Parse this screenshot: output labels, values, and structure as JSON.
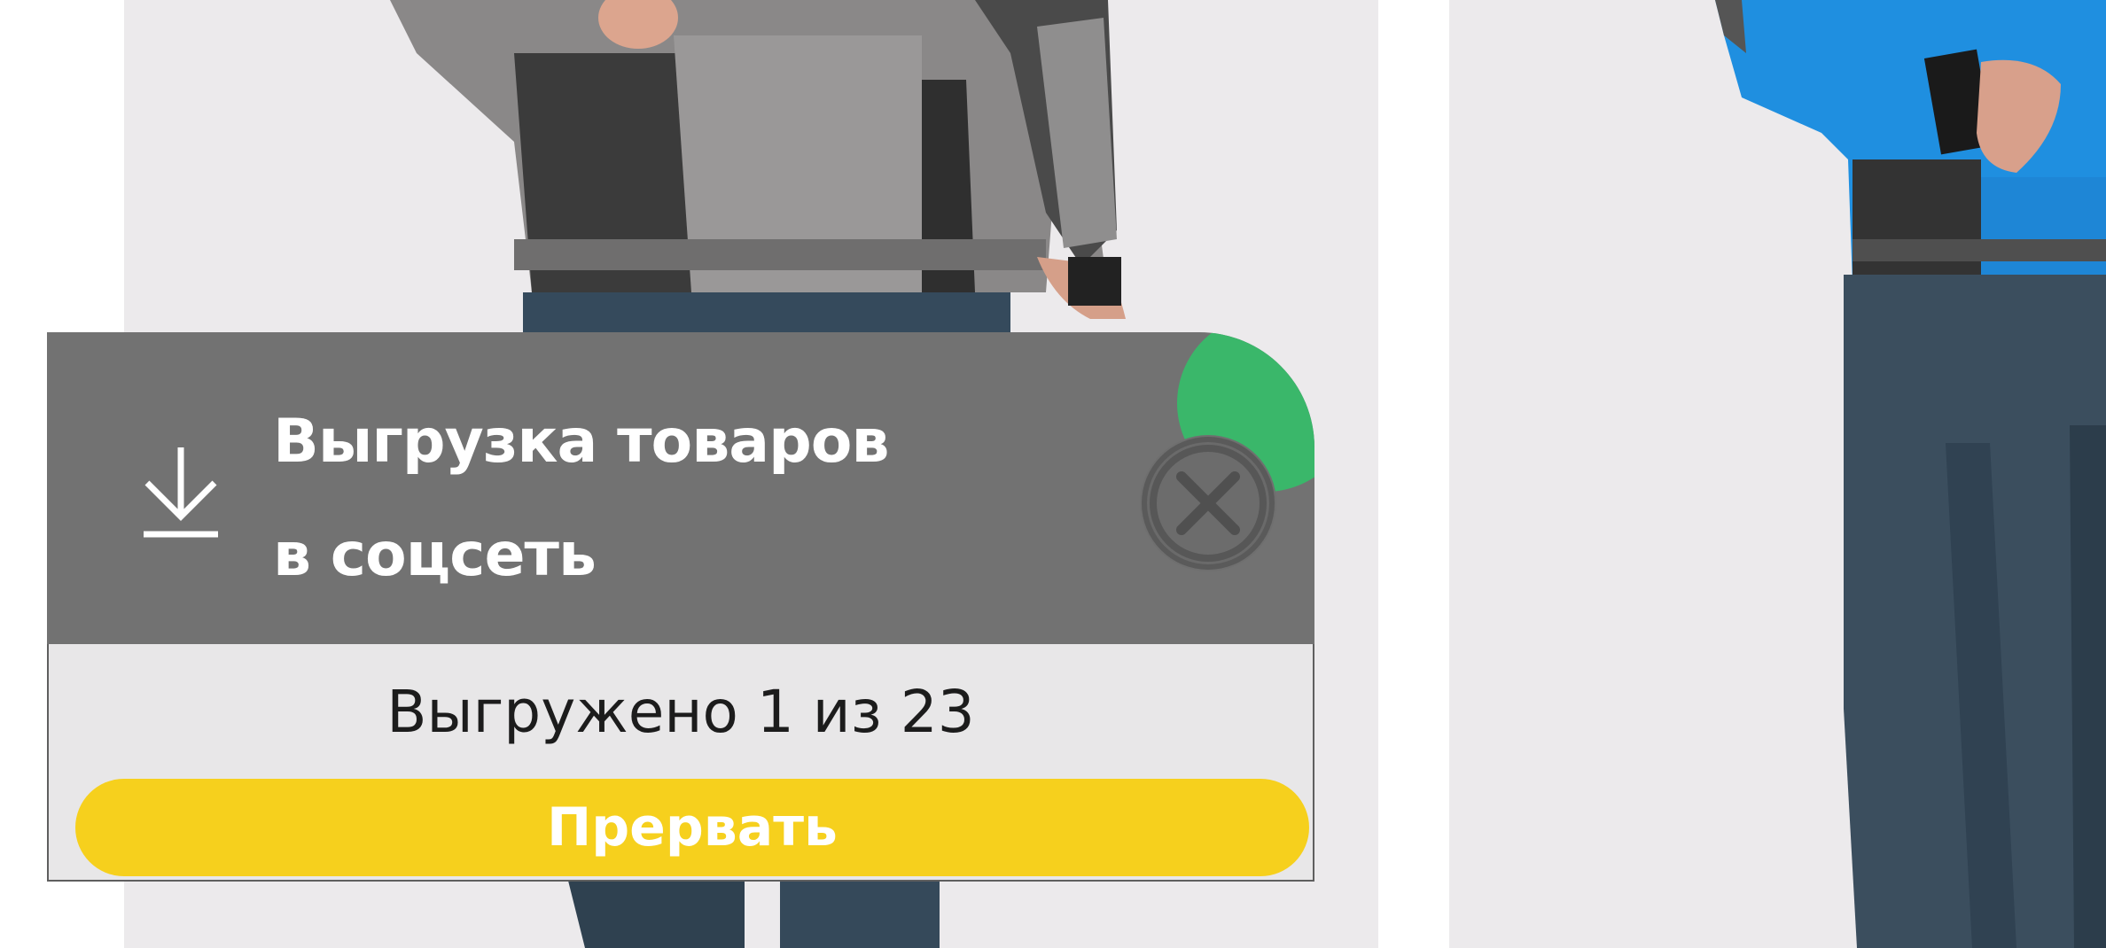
{
  "dialog": {
    "title_line1": "Выгрузка товаров",
    "title_line2": "в соцсеть",
    "progress_text": "Выгружено 1 из 23",
    "abort_label": "Прервать",
    "icons": {
      "download": "download-icon",
      "close": "close-icon"
    },
    "colors": {
      "header_bg": "#727272",
      "body_bg": "#e8e7e8",
      "abort_bg": "#f6d01d",
      "status_dot": "#3ab76a"
    }
  },
  "products": [
    {
      "jacket_color": "gray",
      "image": "product-photo"
    },
    {
      "jacket_color": "blue",
      "image": "product-photo"
    }
  ]
}
